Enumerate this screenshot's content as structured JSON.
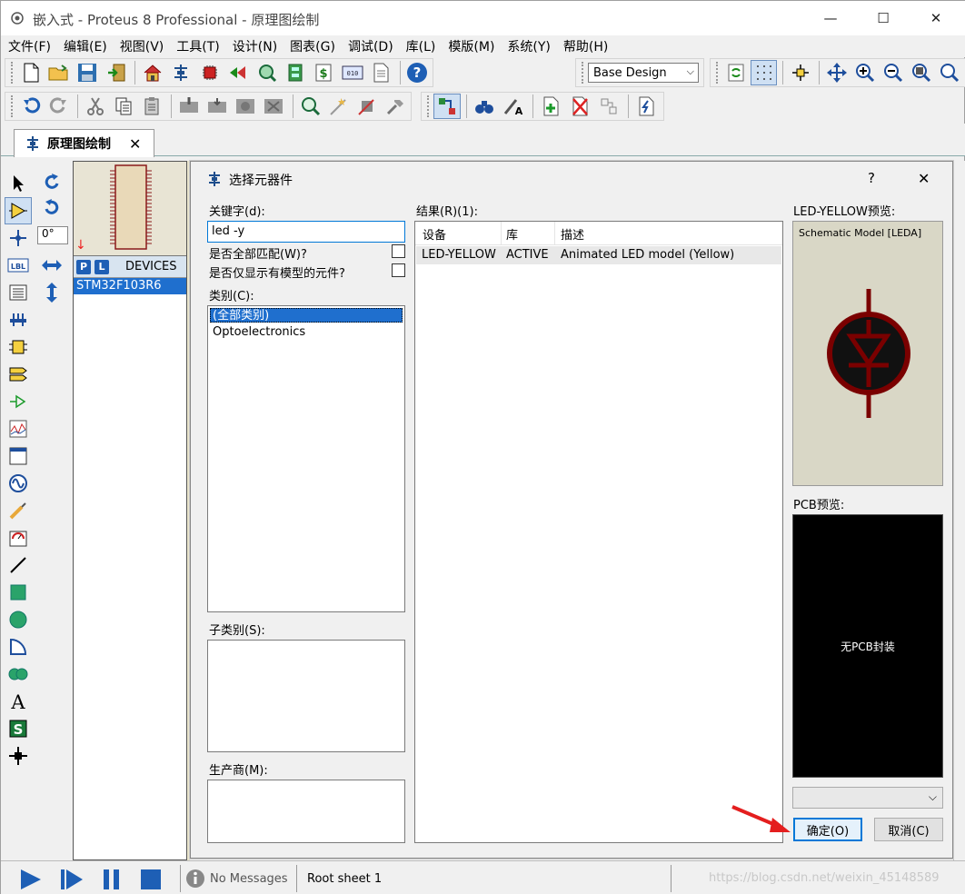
{
  "window": {
    "title": "嵌入式 - Proteus 8 Professional - 原理图绘制",
    "min": "—",
    "max": "☐",
    "close": "✕"
  },
  "menu": [
    "文件(F)",
    "编辑(E)",
    "视图(V)",
    "工具(T)",
    "设计(N)",
    "图表(G)",
    "调试(D)",
    "库(L)",
    "模版(M)",
    "系统(Y)",
    "帮助(H)"
  ],
  "toolbar": {
    "design_select": "Base Design"
  },
  "tab": {
    "label": "原理图绘制",
    "close": "✕"
  },
  "rotation": {
    "angle": "0°"
  },
  "devices": {
    "p_button": "P",
    "l_button": "L",
    "header": "DEVICES",
    "items": [
      "STM32F103R6"
    ]
  },
  "dialog": {
    "title": "选择元器件",
    "help": "?",
    "close": "✕",
    "keyword_label": "关键字(d):",
    "keyword_value": "led -y",
    "match_all_label": "是否全部匹配(W)?",
    "only_models_label": "是否仅显示有模型的元件?",
    "category_label": "类别(C):",
    "categories": [
      "(全部类别)",
      "Optoelectronics"
    ],
    "subcategory_label": "子类别(S):",
    "manufacturer_label": "生产商(M):",
    "results_label": "结果(R)(1):",
    "results_columns": [
      "设备",
      "库",
      "描述"
    ],
    "results_rows": [
      [
        "LED-YELLOW",
        "ACTIVE",
        "Animated LED model (Yellow)"
      ]
    ],
    "preview_label": "LED-YELLOW预览:",
    "preview_caption": "Schematic Model [LEDA]",
    "pcb_label": "PCB预览:",
    "pcb_caption": "无PCB封装",
    "ok_button": "确定(O)",
    "cancel_button": "取消(C)"
  },
  "status": {
    "messages": "No Messages",
    "sheet": "Root sheet 1",
    "watermark": "https://blog.csdn.net/weixin_45148589"
  }
}
